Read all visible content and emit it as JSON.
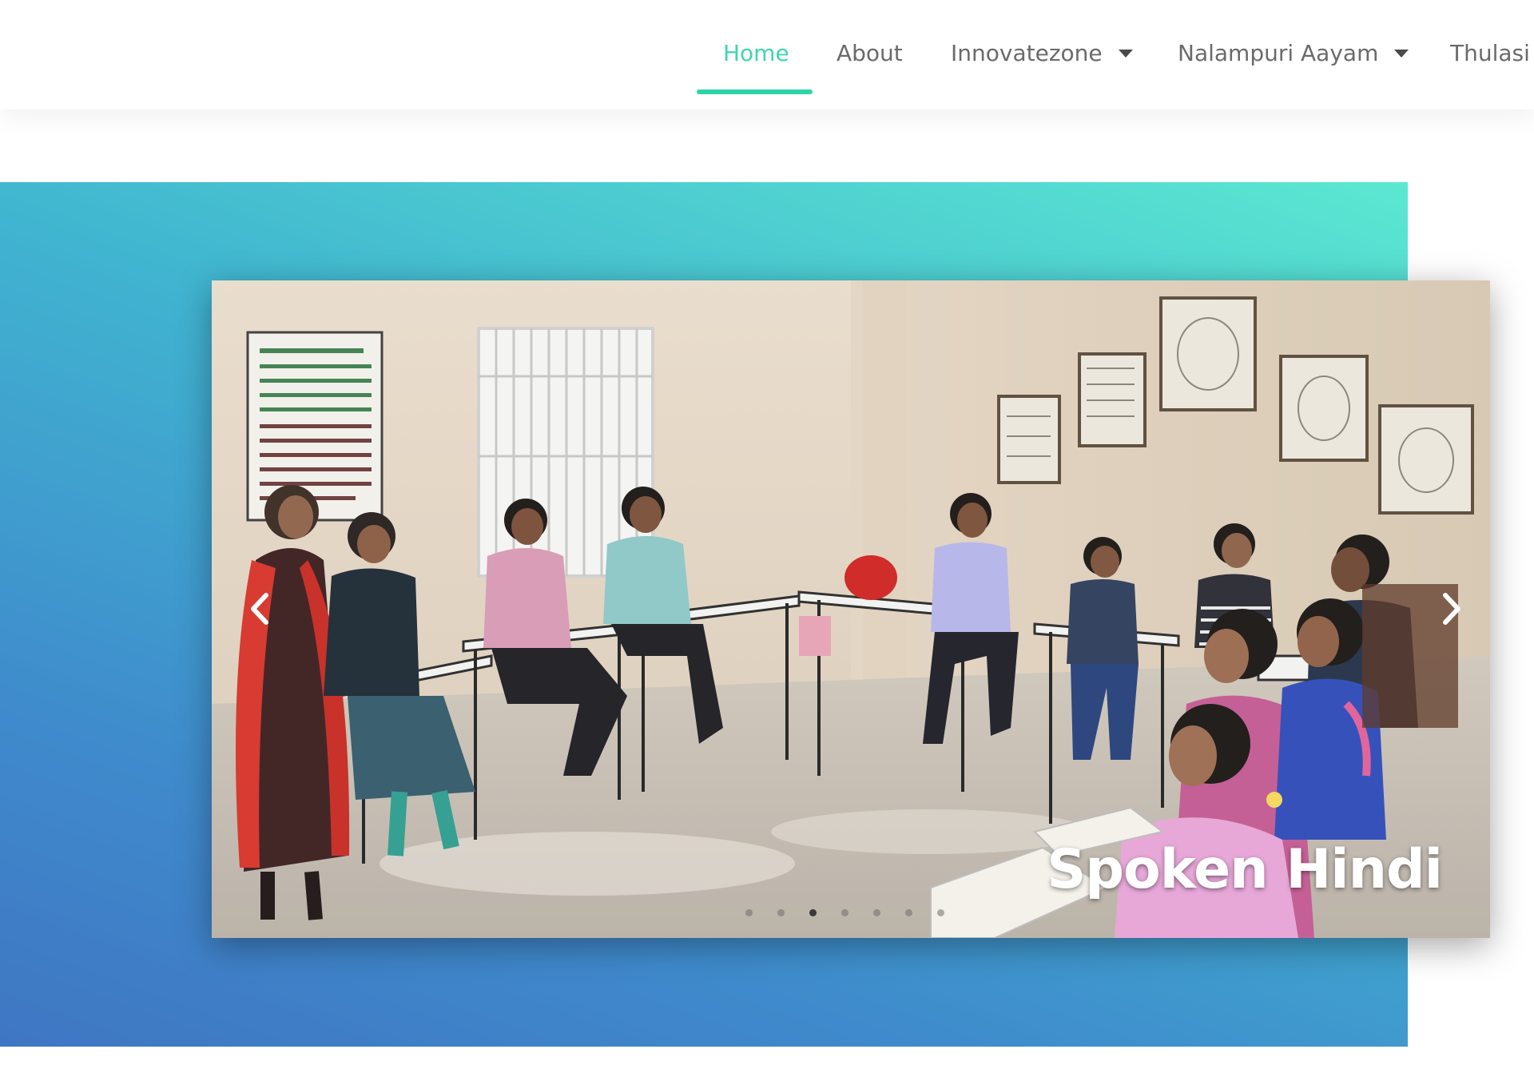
{
  "nav": {
    "items": [
      {
        "label": "Home",
        "active": true,
        "dropdown": false
      },
      {
        "label": "About",
        "active": false,
        "dropdown": false
      },
      {
        "label": "Innovatezone",
        "active": false,
        "dropdown": true
      },
      {
        "label": "Nalampuri Aayam",
        "active": false,
        "dropdown": true
      },
      {
        "label": "Thulasi",
        "active": false,
        "dropdown": false
      }
    ],
    "accent_color": "#2fd4a8"
  },
  "slider": {
    "caption": "Spoken Hindi",
    "slide_count": 7,
    "active_slide": 3,
    "prev_icon": "chevron-left-icon",
    "next_icon": "chevron-right-icon"
  },
  "hero": {
    "gradient_colors": [
      "#5be8d1",
      "#40b4d0",
      "#3f8bcc",
      "#3f76c3"
    ]
  }
}
